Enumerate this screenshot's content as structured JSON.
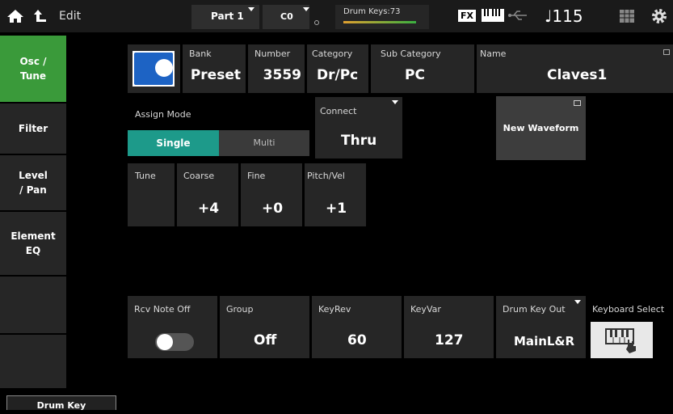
{
  "header": {
    "edit_label": "Edit",
    "part": "Part 1",
    "note": "C0",
    "drum_keys": "Drum Keys:73",
    "fx": "FX",
    "tempo": "♩115"
  },
  "tabs": [
    {
      "label": "Osc /\nTune"
    },
    {
      "label": "Filter"
    },
    {
      "label": "Level\n/ Pan"
    },
    {
      "label": "Element\nEQ"
    }
  ],
  "bottom_tab": "Drum Key",
  "waveform": {
    "bank_label": "Bank",
    "bank": "Preset",
    "number_label": "Number",
    "number": "3559",
    "category_label": "Category",
    "category": "Dr/Pc",
    "subcategory_label": "Sub Category",
    "subcategory": "PC",
    "name_label": "Name",
    "name": "Claves1",
    "switch_on": true
  },
  "assign": {
    "label": "Assign Mode",
    "single": "Single",
    "multi": "Multi",
    "selected": "Single"
  },
  "connect": {
    "label": "Connect",
    "value": "Thru"
  },
  "new_waveform": "New Waveform",
  "tune": {
    "label": "Tune",
    "coarse_label": "Coarse",
    "coarse": "+4",
    "fine_label": "Fine",
    "fine": "+0",
    "pitchvel_label": "Pitch/Vel",
    "pitchvel": "+1"
  },
  "bottom": {
    "rcv_label": "Rcv Note Off",
    "rcv_on": false,
    "group_label": "Group",
    "group": "Off",
    "keyrev_label": "KeyRev",
    "keyrev": "60",
    "keyvar_label": "KeyVar",
    "keyvar": "127",
    "drumout_label": "Drum Key Out",
    "drumout": "MainL&R",
    "kbd_label": "Keyboard Select"
  },
  "colors": {
    "accent_green": "#3a9a3a",
    "teal": "#1d9a8a",
    "switch_blue": "#1d63c4"
  }
}
